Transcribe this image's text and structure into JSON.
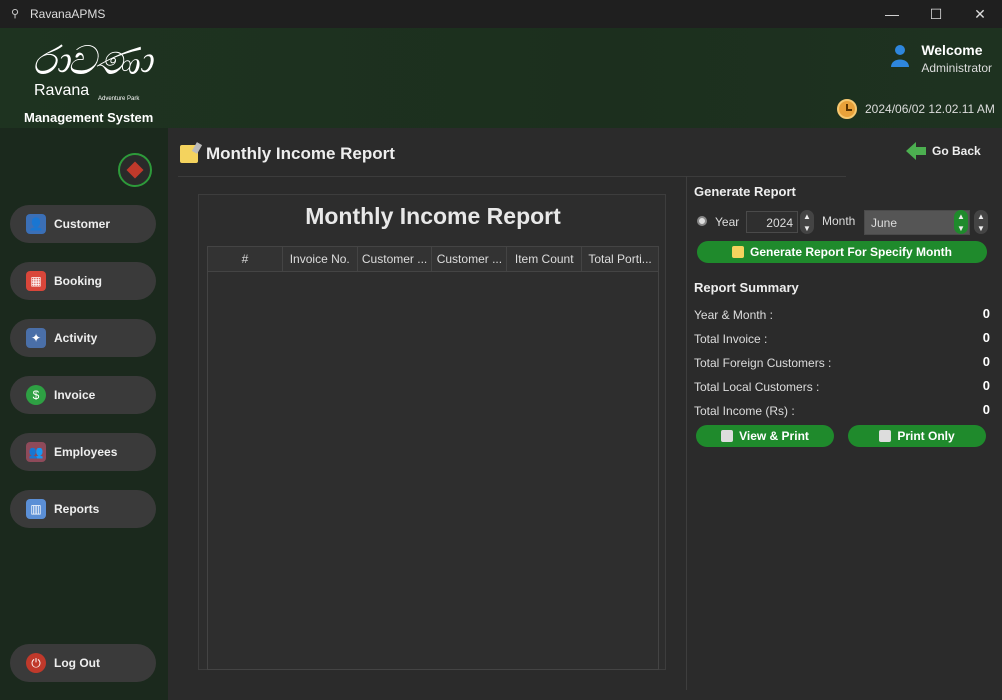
{
  "window": {
    "title": "RavanaAPMS",
    "minimize": "—",
    "maximize": "☐",
    "close": "✕"
  },
  "header": {
    "logo_sinhala": "රාවණා",
    "logo_ravana": "Ravana",
    "logo_sub": "Adventure Park",
    "logo_system": "Management System",
    "welcome": "Welcome",
    "role": "Administrator",
    "datetime": "2024/06/02 12.02.11 AM"
  },
  "sidebar": {
    "items": [
      {
        "label": "Customer",
        "icon": "customer-icon"
      },
      {
        "label": "Booking",
        "icon": "calendar-icon"
      },
      {
        "label": "Activity",
        "icon": "activity-icon"
      },
      {
        "label": "Invoice",
        "icon": "dollar-icon"
      },
      {
        "label": "Employees",
        "icon": "employees-icon"
      },
      {
        "label": "Reports",
        "icon": "chart-icon"
      }
    ],
    "logout": "Log Out"
  },
  "page": {
    "title": "Monthly Income Report",
    "go_back": "Go Back"
  },
  "report": {
    "title": "Monthly Income Report",
    "columns": [
      "#",
      "Invoice No.",
      "Customer ...",
      "Customer ...",
      "Item Count",
      "Total Porti..."
    ]
  },
  "generate": {
    "heading": "Generate Report",
    "year_label": "Year",
    "year_value": "2024",
    "month_label": "Month",
    "month_value": "June",
    "button": "Generate Report For Specify Month"
  },
  "summary": {
    "heading": "Report Summary",
    "rows": [
      {
        "label": "Year & Month :",
        "value": "0"
      },
      {
        "label": "Total Invoice :",
        "value": "0"
      },
      {
        "label": "Total Foreign Customers :",
        "value": "0"
      },
      {
        "label": "Total Local Customers :",
        "value": "0"
      },
      {
        "label": "Total Income (Rs) :",
        "value": "0"
      }
    ],
    "view_print": "View & Print",
    "print_only": "Print Only"
  },
  "colors": {
    "accent": "#1f8a2c",
    "header_bg": "#1e3320",
    "sidebar_bg": "#1b291d"
  }
}
